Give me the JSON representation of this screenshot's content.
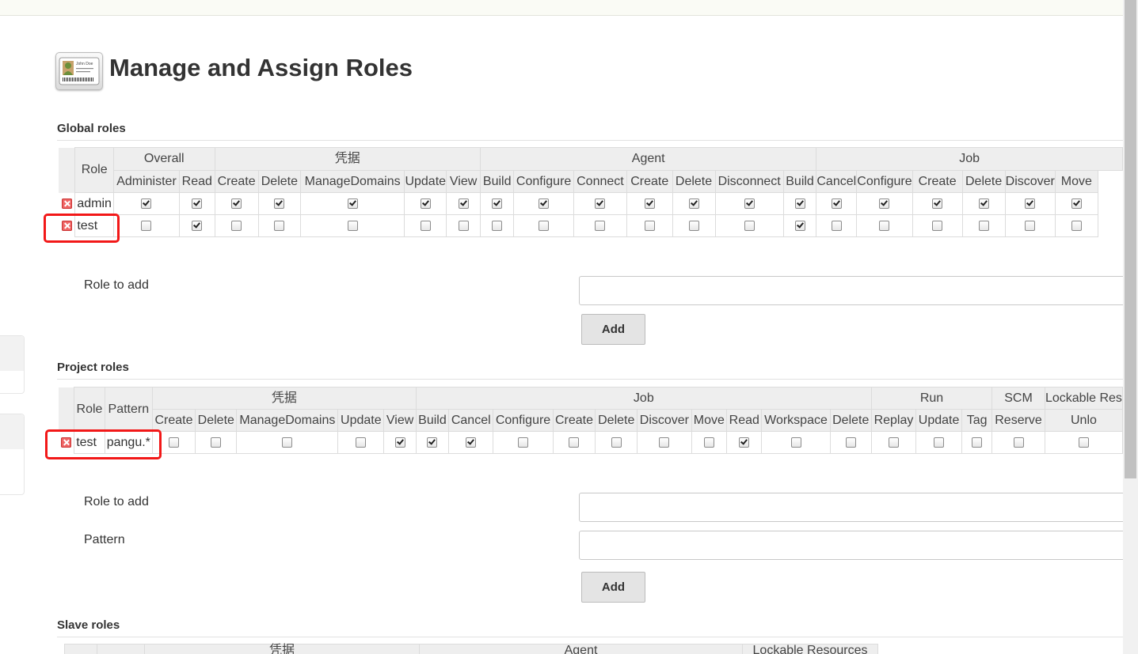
{
  "page": {
    "title": "Manage and Assign Roles",
    "icon": "user-id-card-icon",
    "icon_text": "John Doe"
  },
  "global_roles": {
    "heading": "Global roles",
    "role_header": "Role",
    "groups": [
      {
        "label": "Overall",
        "span": 2
      },
      {
        "label": "凭据",
        "span": 5
      },
      {
        "label": "Agent",
        "span": 7
      },
      {
        "label": "Job",
        "span": 7
      }
    ],
    "permissions": [
      "Administer",
      "Read",
      "Create",
      "Delete",
      "ManageDomains",
      "Update",
      "View",
      "Build",
      "Configure",
      "Connect",
      "Create",
      "Delete",
      "Disconnect",
      "Build",
      "Cancel",
      "Configure",
      "Create",
      "Delete",
      "Discover",
      "Move"
    ],
    "rows": [
      {
        "name": "admin",
        "checks": [
          true,
          true,
          true,
          true,
          true,
          true,
          true,
          true,
          true,
          true,
          true,
          true,
          true,
          true,
          true,
          true,
          true,
          true,
          true,
          true
        ]
      },
      {
        "name": "test",
        "checks": [
          false,
          true,
          false,
          false,
          false,
          false,
          false,
          false,
          false,
          false,
          false,
          false,
          false,
          true,
          false,
          false,
          false,
          false,
          false,
          false
        ]
      }
    ],
    "role_to_add_label": "Role to add",
    "role_to_add_value": "",
    "add_label": "Add"
  },
  "project_roles": {
    "heading": "Project roles",
    "role_header": "Role",
    "pattern_header": "Pattern",
    "groups": [
      {
        "label": "凭据",
        "span": 5
      },
      {
        "label": "Job",
        "span": 10
      },
      {
        "label": "Run",
        "span": 3
      },
      {
        "label": "SCM",
        "span": 1
      },
      {
        "label": "Lockable Res",
        "span": 2
      }
    ],
    "permissions": [
      "Create",
      "Delete",
      "ManageDomains",
      "Update",
      "View",
      "Build",
      "Cancel",
      "Configure",
      "Create",
      "Delete",
      "Discover",
      "Move",
      "Read",
      "Workspace",
      "Delete",
      "Replay",
      "Update",
      "Tag",
      "Reserve",
      "Unlo"
    ],
    "rows": [
      {
        "name": "test",
        "pattern": "pangu.*",
        "checks": [
          false,
          false,
          false,
          false,
          true,
          true,
          true,
          false,
          false,
          false,
          false,
          false,
          true,
          false,
          false,
          false,
          false,
          false,
          false,
          false
        ]
      }
    ],
    "role_to_add_label": "Role to add",
    "role_to_add_value": "",
    "pattern_label": "Pattern",
    "pattern_value": "",
    "add_label": "Add"
  },
  "slave_roles": {
    "heading": "Slave roles",
    "groups": [
      {
        "label": "凭据"
      },
      {
        "label": "Agent"
      },
      {
        "label": "Lockable Resources"
      }
    ]
  },
  "colors": {
    "highlight": "#f21818",
    "header_bg": "#eeeeee",
    "delete_icon": "#e66666"
  }
}
